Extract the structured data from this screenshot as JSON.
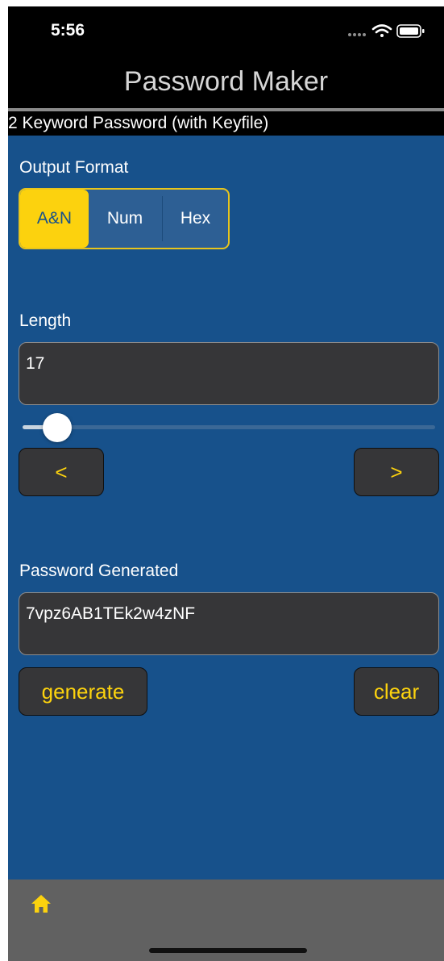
{
  "status_bar": {
    "time": "5:56",
    "signal_icon": "signal-dots-icon",
    "wifi_icon": "wifi-icon",
    "battery_icon": "battery-icon"
  },
  "nav": {
    "title": "Password Maker"
  },
  "mode_title": "2 Keyword Password (with Keyfile)",
  "output_format": {
    "label": "Output Format",
    "options": [
      "A&N",
      "Num",
      "Hex"
    ],
    "selected": "A&N"
  },
  "length": {
    "label": "Length",
    "value": "17",
    "decrement_label": "<",
    "increment_label": ">"
  },
  "password": {
    "label": "Password Generated",
    "value": "7vpz6AB1TEk2w4zNF",
    "generate_label": "generate",
    "clear_label": "clear"
  },
  "tab_bar": {
    "home_icon": "home-icon"
  },
  "colors": {
    "background": "#17518b",
    "accent": "#fcd20e",
    "field": "#363638",
    "tab_bar": "#616161"
  }
}
